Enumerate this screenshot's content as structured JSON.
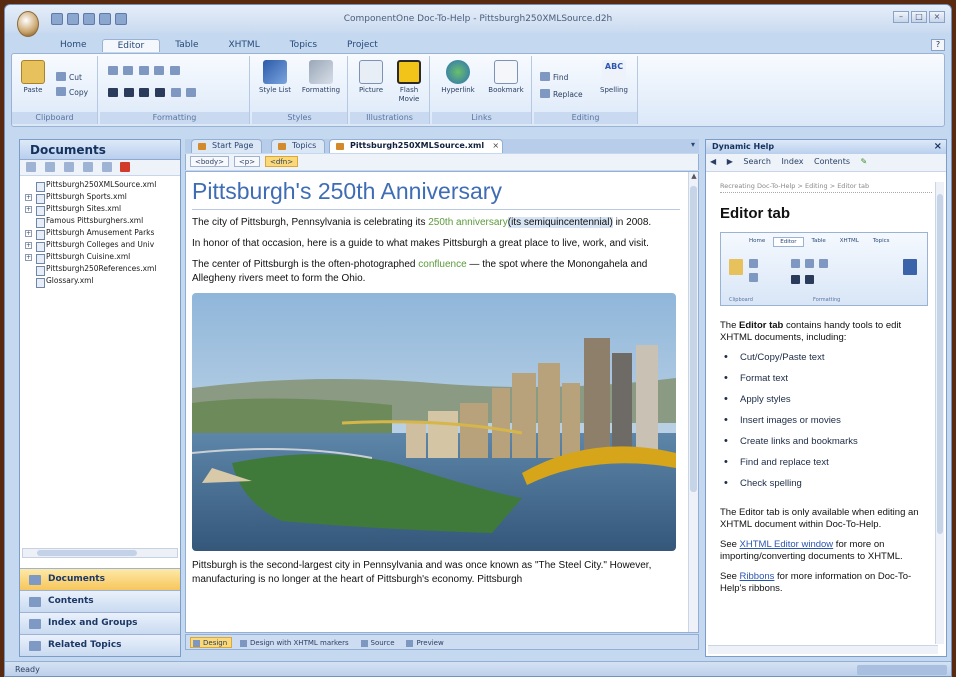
{
  "window": {
    "title": "ComponentOne Doc-To-Help - Pittsburgh250XMLSource.d2h"
  },
  "ribbon": {
    "tabs": [
      "Home",
      "Editor",
      "Table",
      "XHTML",
      "Topics",
      "Project"
    ],
    "active_tab": "Editor",
    "groups": {
      "clipboard": {
        "label": "Clipboard",
        "paste": "Paste",
        "cut": "Cut",
        "copy": "Copy"
      },
      "formatting": {
        "label": "Formatting"
      },
      "styles": {
        "label": "Styles",
        "style_list": "Style List",
        "formatting": "Formatting"
      },
      "illustrations": {
        "label": "Illustrations",
        "picture": "Picture",
        "flash_movie": "Flash Movie"
      },
      "links": {
        "label": "Links",
        "hyperlink": "Hyperlink",
        "bookmark": "Bookmark"
      },
      "editing": {
        "label": "Editing",
        "find": "Find",
        "replace": "Replace",
        "spelling": "Spelling",
        "spelling_badge": "ABC"
      }
    }
  },
  "documents_pane": {
    "title": "Documents",
    "files": [
      {
        "name": "Pittsburgh250XMLSource.xml",
        "expandable": false
      },
      {
        "name": "Pittsburgh Sports.xml",
        "expandable": true
      },
      {
        "name": "Pittsburgh Sites.xml",
        "expandable": true
      },
      {
        "name": "Famous Pittsburghers.xml",
        "expandable": false
      },
      {
        "name": "Pittsburgh Amusement Parks",
        "expandable": true
      },
      {
        "name": "Pittsburgh Colleges and Univ",
        "expandable": true
      },
      {
        "name": "Pittsburgh Cuisine.xml",
        "expandable": true
      },
      {
        "name": "Pittsburgh250References.xml",
        "expandable": false
      },
      {
        "name": "Glossary.xml",
        "expandable": false
      }
    ],
    "nav": [
      "Documents",
      "Contents",
      "Index and Groups",
      "Related Topics"
    ],
    "active_nav": "Documents"
  },
  "document_tabs": [
    {
      "label": "Start Page",
      "active": false
    },
    {
      "label": "Topics",
      "active": false
    },
    {
      "label": "Pittsburgh250XMLSource.xml",
      "active": true
    }
  ],
  "tag_bar": [
    "<body>",
    "<p>",
    "<dfn>"
  ],
  "editor": {
    "title": "Pittsburgh's 250th Anniversary",
    "p1_a": "The city of Pittsburgh, Pennsylvania is celebrating its ",
    "p1_link": "250th anniversary",
    "p1_hl": "(its semiquincentennial)",
    "p1_b": " in 2008.",
    "p2": "In honor of that occasion, here is a guide to what makes Pittsburgh a great place to live, work, and visit.",
    "p3_a": "The center of Pittsburgh is the often-photographed ",
    "p3_link": "confluence",
    "p3_b": " — the spot where the Monongahela and  Allegheny rivers meet to form the Ohio.",
    "p4": "Pittsburgh is the second-largest city in Pennsylvania and was once known as \"The Steel City.\" However, manufacturing is no longer at the heart of Pittsburgh's economy. Pittsburgh"
  },
  "view_tabs": [
    "Design",
    "Design with XHTML markers",
    "Source",
    "Preview"
  ],
  "active_view": "Design",
  "help_pane": {
    "title": "Dynamic Help",
    "toolbar": [
      "Search",
      "Index",
      "Contents"
    ],
    "crumb": "Recreating Doc-To-Help > Editing > Editor tab",
    "heading": "Editor tab",
    "mini_tabs": [
      "Home",
      "Editor",
      "Table",
      "XHTML",
      "Topics"
    ],
    "mini_groups": [
      "Clipboard",
      "Formatting"
    ],
    "intro_a": "The ",
    "intro_b": "Editor tab",
    "intro_c": " contains handy tools to edit XHTML documents, including:",
    "items": [
      "Cut/Copy/Paste text",
      "Format text",
      "Apply styles",
      "Insert images or movies",
      "Create links and bookmarks",
      "Find and replace text",
      "Check spelling"
    ],
    "note": "The Editor tab is only available when editing an XHTML document within Doc-To-Help.",
    "see1_a": "See ",
    "see1_link": "XHTML Editor window",
    "see1_b": " for more on importing/converting documents to XHTML.",
    "see2_a": "See ",
    "see2_link": "Ribbons",
    "see2_b": " for more information on Doc-To-Help's ribbons."
  },
  "status": {
    "text": "Ready"
  }
}
